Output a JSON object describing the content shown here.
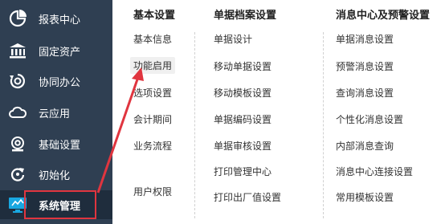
{
  "sidebar": {
    "items": [
      {
        "label": "报表中心",
        "icon": "chart-pie-icon"
      },
      {
        "label": "固定资产",
        "icon": "bank-icon"
      },
      {
        "label": "协同办公",
        "icon": "sync-icon"
      },
      {
        "label": "云应用",
        "icon": "cloud-icon"
      },
      {
        "label": "基础设置",
        "icon": "settings-icon"
      },
      {
        "label": "初始化",
        "icon": "refresh-icon"
      },
      {
        "label": "系统管理",
        "icon": "monitor-icon"
      }
    ]
  },
  "menu": {
    "columns": [
      {
        "title": "基本设置",
        "items": [
          "基本信息",
          "功能启用",
          "选项设置",
          "会计期间",
          "业务流程",
          "用户权限"
        ]
      },
      {
        "title": "单据档案设置",
        "items": [
          "单据设计",
          "移动单据设置",
          "移动模板设置",
          "单据编码设置",
          "单据审核设置",
          "打印管理中心",
          "打印出厂值设置"
        ]
      },
      {
        "title": "消息中心及预警设置",
        "items": [
          "单据消息设置",
          "预警消息设置",
          "查询消息设置",
          "个性化消息设置",
          "内部消息查询",
          "消息中心连接设置",
          "常用模板设置"
        ]
      }
    ]
  },
  "colors": {
    "sidebar_bg": "#2f3f52",
    "highlight": "#e0353f"
  }
}
